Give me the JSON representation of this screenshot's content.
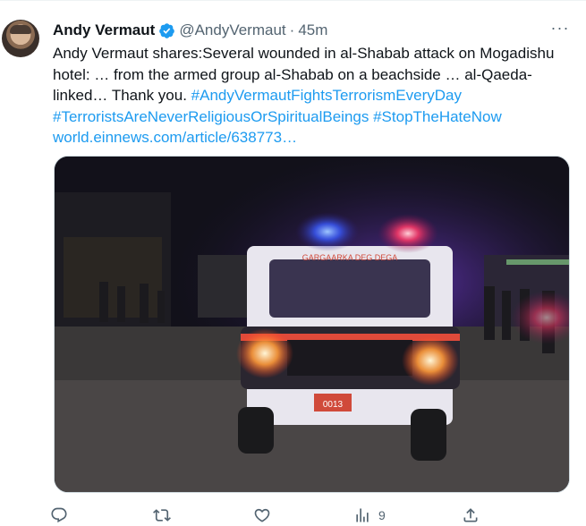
{
  "tweet": {
    "author_name": "Andy Vermaut",
    "handle": "@AndyVermaut",
    "separator": "·",
    "time": "45m",
    "more_label": "···",
    "text_lines": [
      "Andy Vermaut shares:Several wounded in al-Shabab attack on Mogadishu",
      "hotel: … from the armed group al-Shabab on a beachside … al-Qaeda-",
      "linked… Thank you."
    ],
    "hashtag_1": "#AndyVermautFightsTerrorismEveryDay",
    "hashtag_2": "#TerroristsAreNeverReligiousOrSpiritualBeings",
    "hashtag_3": "#StopTheHateNow",
    "link": "world.einnews.com/article/638773…",
    "media_vehicle_text": "GARGAARKA DEG DEGA"
  },
  "actions": {
    "views_count": "9"
  },
  "colors": {
    "accent": "#1d9bf0",
    "text": "#0f1419",
    "muted": "#536471"
  }
}
